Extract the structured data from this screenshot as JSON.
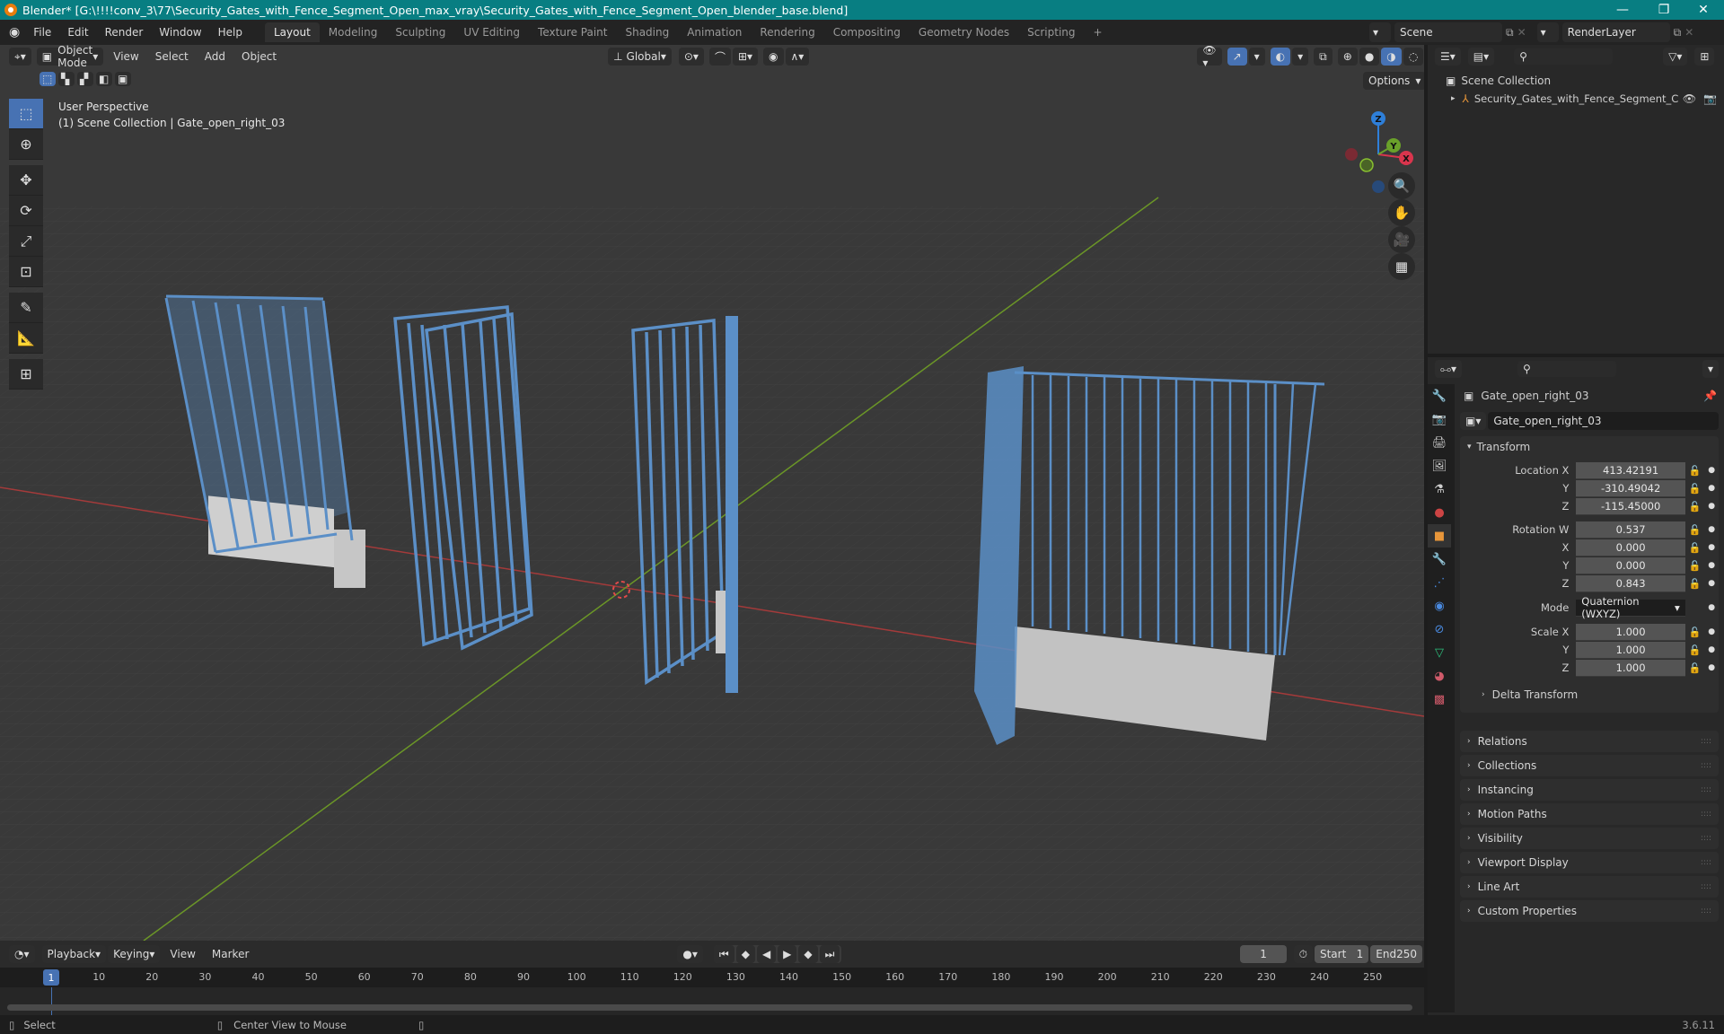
{
  "window": {
    "title": "Blender* [G:\\!!!!conv_3\\77\\Security_Gates_with_Fence_Segment_Open_max_vray\\Security_Gates_with_Fence_Segment_Open_blender_base.blend]",
    "minimize": "—",
    "maximize": "❐",
    "close": "✕"
  },
  "menu": [
    "File",
    "Edit",
    "Render",
    "Window",
    "Help"
  ],
  "workspaces": [
    "Layout",
    "Modeling",
    "Sculpting",
    "UV Editing",
    "Texture Paint",
    "Shading",
    "Animation",
    "Rendering",
    "Compositing",
    "Geometry Nodes",
    "Scripting"
  ],
  "active_workspace": "Layout",
  "add_workspace": "+",
  "scene": {
    "label": "Scene",
    "view_layer": "RenderLayer"
  },
  "viewport": {
    "mode": "Object Mode",
    "menus": [
      "View",
      "Select",
      "Add",
      "Object"
    ],
    "orientation": "Global",
    "options_label": "Options",
    "overlay_title": "User Perspective",
    "overlay_subtitle": "(1) Scene Collection | Gate_open_right_03",
    "gizmo_axes": {
      "x": "X",
      "y": "Y",
      "z": "Z"
    },
    "colors": {
      "gate": "#5b8fc7",
      "concrete": "#c8c8c8",
      "x_axis": "#b23a3a",
      "y_axis": "#6e9a27",
      "bg": "#393939"
    }
  },
  "outliner": {
    "root": "Scene Collection",
    "items": [
      {
        "label": "Security_Gates_with_Fence_Segment_C"
      }
    ]
  },
  "properties": {
    "object_name": "Gate_open_right_03",
    "data_name": "Gate_open_right_03",
    "transform_label": "Transform",
    "location": {
      "label": "Location X",
      "x": "413.42191",
      "y": "-310.49042",
      "z": "-115.45000"
    },
    "rotation": {
      "label": "Rotation W",
      "w": "0.537",
      "x": "0.000",
      "y": "0.000",
      "z": "0.843"
    },
    "mode": {
      "label": "Mode",
      "value": "Quaternion (WXYZ)"
    },
    "scale": {
      "label": "Scale X",
      "x": "1.000",
      "y": "1.000",
      "z": "1.000"
    },
    "axis_labels": {
      "x": "X",
      "y": "Y",
      "z": "Z"
    },
    "delta": "Delta Transform",
    "panels": [
      "Relations",
      "Collections",
      "Instancing",
      "Motion Paths",
      "Visibility",
      "Viewport Display",
      "Line Art",
      "Custom Properties"
    ]
  },
  "timeline": {
    "menus": [
      "Playback",
      "Keying",
      "View",
      "Marker"
    ],
    "current_frame": "1",
    "start_label": "Start",
    "start": "1",
    "end_label": "End",
    "end": "250",
    "ticks": [
      "10",
      "20",
      "30",
      "40",
      "50",
      "60",
      "70",
      "80",
      "90",
      "100",
      "110",
      "120",
      "130",
      "140",
      "150",
      "160",
      "170",
      "180",
      "190",
      "200",
      "210",
      "220",
      "230",
      "240",
      "250"
    ],
    "playhead": "1"
  },
  "status": {
    "select": "Select",
    "center": "Center View to Mouse",
    "version": "3.6.11"
  }
}
